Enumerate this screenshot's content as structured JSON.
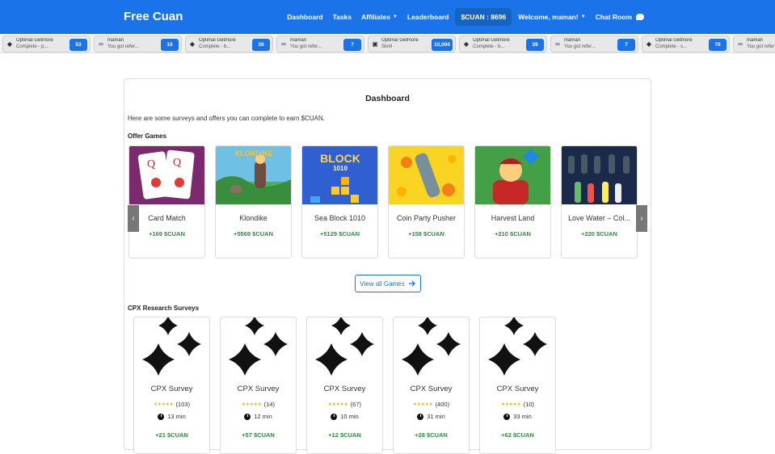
{
  "navbar": {
    "brand": "Free Cuan",
    "links": {
      "dashboard": "Dashboard",
      "tasks": "Tasks",
      "affiliates": "Affiliates",
      "leaderboard": "Leaderboard",
      "balance": "$CUAN : 8696",
      "welcome": "Welcome, maman!",
      "chat": "Chat Room"
    }
  },
  "ticker": [
    {
      "icon": "tag-icon",
      "name": "Optimal Getmore",
      "sub": "Complete - p...",
      "value": "53"
    },
    {
      "icon": "infinity-icon",
      "name": "maman",
      "sub": "You got refer...",
      "value": "10"
    },
    {
      "icon": "tag-icon",
      "name": "Optimal Getmore",
      "sub": "Complete - b...",
      "value": "39"
    },
    {
      "icon": "infinity-icon",
      "name": "maman",
      "sub": "You got refer...",
      "value": "7"
    },
    {
      "icon": "gift-icon",
      "name": "Optimal Getmore",
      "sub": "Skrill",
      "value": "10,000"
    },
    {
      "icon": "tag-icon",
      "name": "Optimal Getmore",
      "sub": "Complete - b...",
      "value": "39"
    },
    {
      "icon": "infinity-icon",
      "name": "maman",
      "sub": "You got refer...",
      "value": "7"
    },
    {
      "icon": "tag-icon",
      "name": "Optimal Getmore",
      "sub": "Complete - s...",
      "value": "70"
    },
    {
      "icon": "infinity-icon",
      "name": "maman",
      "sub": "You got refer",
      "value": ""
    }
  ],
  "dashboard": {
    "title": "Dashboard",
    "intro": "Here are some surveys and offers you can complete to earn $CUAN.",
    "offer_label": "Offer Games",
    "games": [
      {
        "name": "Card Match",
        "reward": "+169 $CUAN"
      },
      {
        "name": "Klondike",
        "reward": "+5569 $CUAN"
      },
      {
        "name": "Sea Block 1010",
        "reward": "+5129 $CUAN"
      },
      {
        "name": "Coin Party Pusher",
        "reward": "+158 $CUAN"
      },
      {
        "name": "Harvest Land",
        "reward": "+210 $CUAN"
      },
      {
        "name": "Love Water – Col...",
        "reward": "+220 $CUAN"
      }
    ],
    "thumb_text": {
      "klondike": "KLONDIKE",
      "block": "BLOCK",
      "block_num": "1010"
    },
    "prev_arrow": "‹",
    "next_arrow": "›",
    "view_all": "View all Games",
    "cpx_label": "CPX Research Surveys",
    "surveys": [
      {
        "name": "CPX Survey",
        "stars": "★★★★★",
        "count": "(103)",
        "time": "13 min",
        "reward": "+21 $CUAN"
      },
      {
        "name": "CPX Survey",
        "stars": "★★★★★",
        "count": "(14)",
        "time": "12 min",
        "reward": "+57 $CUAN"
      },
      {
        "name": "CPX Survey",
        "stars": "★★★★★",
        "count": "(67)",
        "time": "10 min",
        "reward": "+12 $CUAN"
      },
      {
        "name": "CPX Survey",
        "stars": "★★★★★",
        "count": "(400)",
        "time": "31 min",
        "reward": "+28 $CUAN"
      },
      {
        "name": "CPX Survey",
        "stars": "★★★★★",
        "count": "(10)",
        "time": "33 min",
        "reward": "+62 $CUAN"
      }
    ]
  },
  "colors": {
    "primary": "#1a73e8",
    "reward_green": "#2e8b3e",
    "star": "#f4b400"
  }
}
